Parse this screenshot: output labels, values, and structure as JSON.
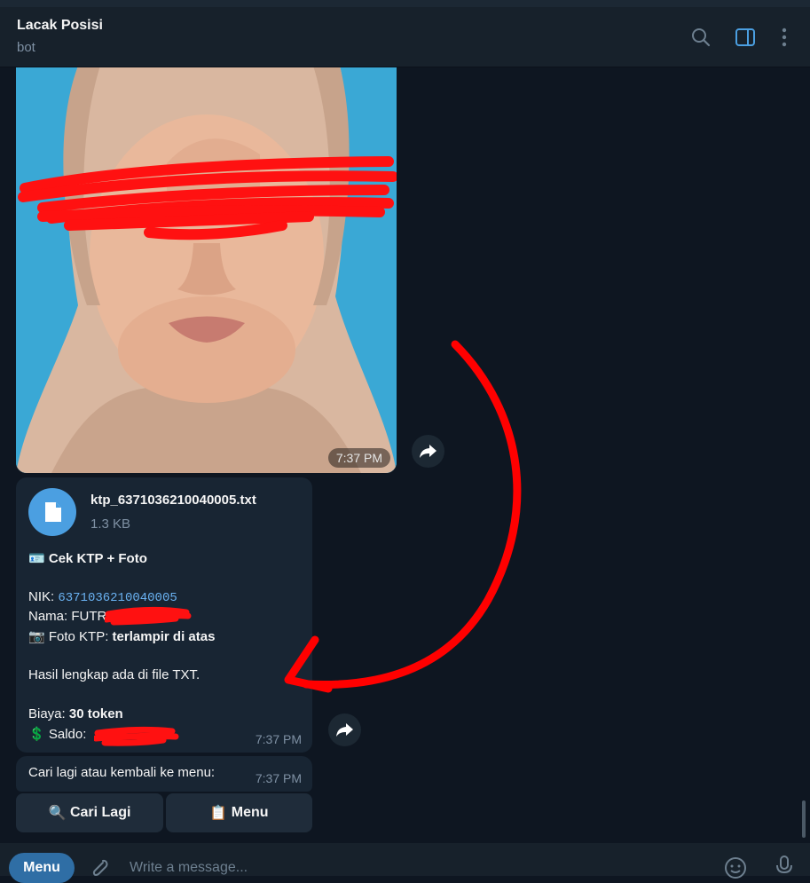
{
  "header": {
    "title": "Lacak Posisi",
    "subtitle": "bot"
  },
  "photo_message": {
    "time": "7:37 PM"
  },
  "file_message": {
    "file_name": "ktp_6371036210040005.txt",
    "file_size": "1.3 KB",
    "heading_emoji": "🪪",
    "heading": "Cek KTP + Foto",
    "nik_label": "NIK: ",
    "nik_value": "6371036210040005",
    "nama_label": "Nama: ",
    "nama_value": "FUTRI",
    "foto_emoji": "📷",
    "foto_label": " Foto KTP: ",
    "foto_value": "terlampir di atas",
    "hasil": "Hasil lengkap ada di file TXT.",
    "biaya_label": "Biaya: ",
    "biaya_value": "30 token",
    "saldo_emoji": "💲",
    "saldo_label": " Saldo: ",
    "time": "7:37 PM"
  },
  "prompt_message": {
    "text": "Cari lagi atau kembali ke menu:",
    "time": "7:37 PM"
  },
  "keyboard": {
    "buttons": [
      {
        "emoji": "🔍",
        "label": "Cari Lagi"
      },
      {
        "emoji": "📋",
        "label": "Menu"
      }
    ]
  },
  "composer": {
    "menu_label": "Menu",
    "placeholder": "Write a message..."
  },
  "colors": {
    "background": "#0e1621",
    "header": "#17212b",
    "bubble": "#182533",
    "accent": "#4b9fe1",
    "annotation_red": "#ff0000"
  }
}
